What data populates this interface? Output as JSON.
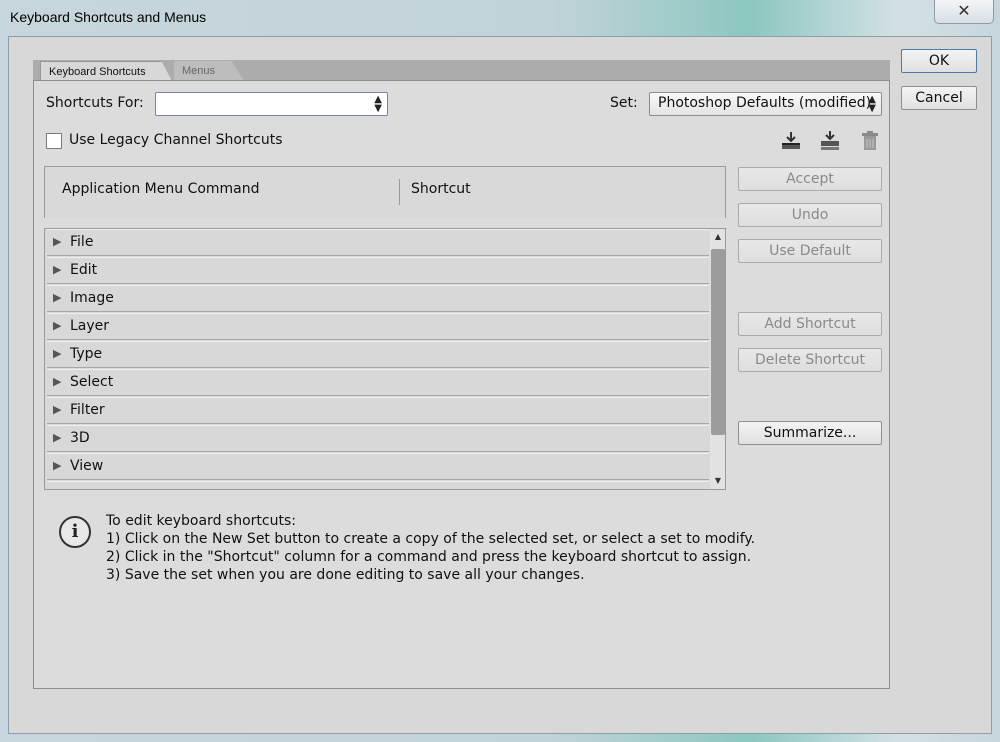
{
  "window": {
    "title": "Keyboard Shortcuts and Menus",
    "close_glyph": "✕"
  },
  "tabs": [
    {
      "label": "Keyboard Shortcuts",
      "active": true
    },
    {
      "label": "Menus",
      "active": false
    }
  ],
  "shortcuts_for": {
    "label": "Shortcuts For:",
    "value": ""
  },
  "set": {
    "label": "Set:",
    "value": "Photoshop Defaults (modified)"
  },
  "legacy_checkbox": {
    "label": "Use Legacy Channel Shortcuts",
    "checked": false
  },
  "toolbar_icons": [
    "save-set-icon",
    "new-set-icon",
    "delete-set-icon"
  ],
  "table": {
    "columns": [
      "Application Menu Command",
      "Shortcut"
    ],
    "rows": [
      {
        "label": "File"
      },
      {
        "label": "Edit"
      },
      {
        "label": "Image"
      },
      {
        "label": "Layer"
      },
      {
        "label": "Type"
      },
      {
        "label": "Select"
      },
      {
        "label": "Filter"
      },
      {
        "label": "3D"
      },
      {
        "label": "View"
      }
    ]
  },
  "side_buttons": {
    "accept": "Accept",
    "undo": "Undo",
    "use_default": "Use Default",
    "add_shortcut": "Add Shortcut",
    "delete_shortcut": "Delete Shortcut",
    "summarize": "Summarize..."
  },
  "dialog_buttons": {
    "ok": "OK",
    "cancel": "Cancel"
  },
  "info": {
    "lines": [
      "To edit keyboard shortcuts:",
      "1) Click on the New Set button to create a copy of the selected set, or select a set to modify.",
      "2) Click in the \"Shortcut\" column for a command and press the keyboard shortcut to assign.",
      "3) Save the set when you are done editing to save all your changes."
    ]
  },
  "colors": {
    "dialog_bg": "#d8d8d8",
    "focus_border": "#6f8aa8",
    "disabled_text": "#8a8a8a"
  }
}
